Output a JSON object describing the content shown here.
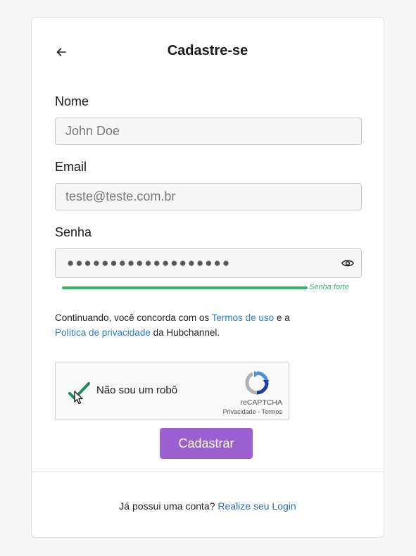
{
  "header": {
    "title": "Cadastre-se",
    "back_icon": "arrow-left-icon"
  },
  "form": {
    "name": {
      "label": "Nome",
      "placeholder": "John Doe",
      "value": ""
    },
    "email": {
      "label": "Email",
      "placeholder": "teste@teste.com.br",
      "value": ""
    },
    "password": {
      "label": "Senha",
      "masked_value": "●●●●●●●●●●●●●●●●●●●",
      "toggle_icon": "eye-icon",
      "strength_label": "Senha forte",
      "strength_level": 1.0,
      "strength_color": "#2fb96d"
    }
  },
  "terms": {
    "prefix": "Continuando, você concorda com os ",
    "terms_link": "Termos de uso",
    "middle": " e a",
    "privacy_link": "Política de privacidade",
    "suffix": " da Hubchannel."
  },
  "recaptcha": {
    "label": "Não sou um robô",
    "checked": true,
    "brand": "reCAPTCHA",
    "privacy": "Privacidade",
    "separator": " - ",
    "terms": "Termos",
    "check_color": "#1f8b5f"
  },
  "submit": {
    "label": "Cadastrar",
    "color": "#9b5fcf"
  },
  "footer": {
    "question": "Já possui uma conta? ",
    "login_link": "Realize seu Login"
  }
}
